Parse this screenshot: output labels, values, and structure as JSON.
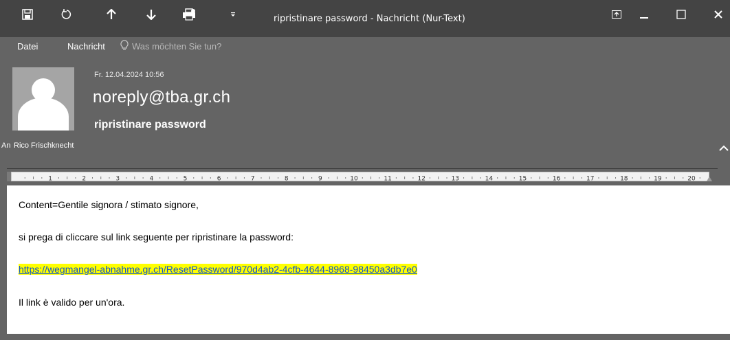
{
  "window": {
    "title": "ripristinare password - Nachricht (Nur-Text)"
  },
  "toolbar": {
    "icons": [
      "save-icon",
      "undo-icon",
      "up-arrow-icon",
      "down-arrow-icon",
      "print-icon",
      "customize-dropdown-icon"
    ]
  },
  "window_controls": {
    "icons": [
      "ribbon-display-options-icon",
      "minimize-icon",
      "maximize-icon",
      "close-icon"
    ]
  },
  "menu": {
    "file_label": "Datei",
    "message_label": "Nachricht",
    "tell_me_placeholder": "Was möchten Sie tun?"
  },
  "header": {
    "date": "Fr. 12.04.2024 10:56",
    "sender": "noreply@tba.gr.ch",
    "subject": "ripristinare password",
    "to_label": "An",
    "to_name": "Rico Frischknecht"
  },
  "ruler": {
    "numbers": [
      "1",
      "2",
      "3",
      "4",
      "5",
      "6",
      "7",
      "8",
      "9",
      "10",
      "11",
      "12",
      "13",
      "14",
      "15",
      "16",
      "17",
      "18",
      "19",
      "20"
    ]
  },
  "body": {
    "line1": "Content=Gentile signora / stimato signore,",
    "line2": "si prega di cliccare sul link seguente per ripristinare la password:",
    "link": "https://wegmangel-abnahme.gr.ch/ResetPassword/970d4ab2-4cfb-4644-8968-98450a3db7e0",
    "line4": "Il link è valido per un'ora."
  },
  "colors": {
    "titlebar": "#444444",
    "header_bg": "#646464",
    "link_highlight": "#ffff00",
    "link_text": "#1155cc"
  }
}
